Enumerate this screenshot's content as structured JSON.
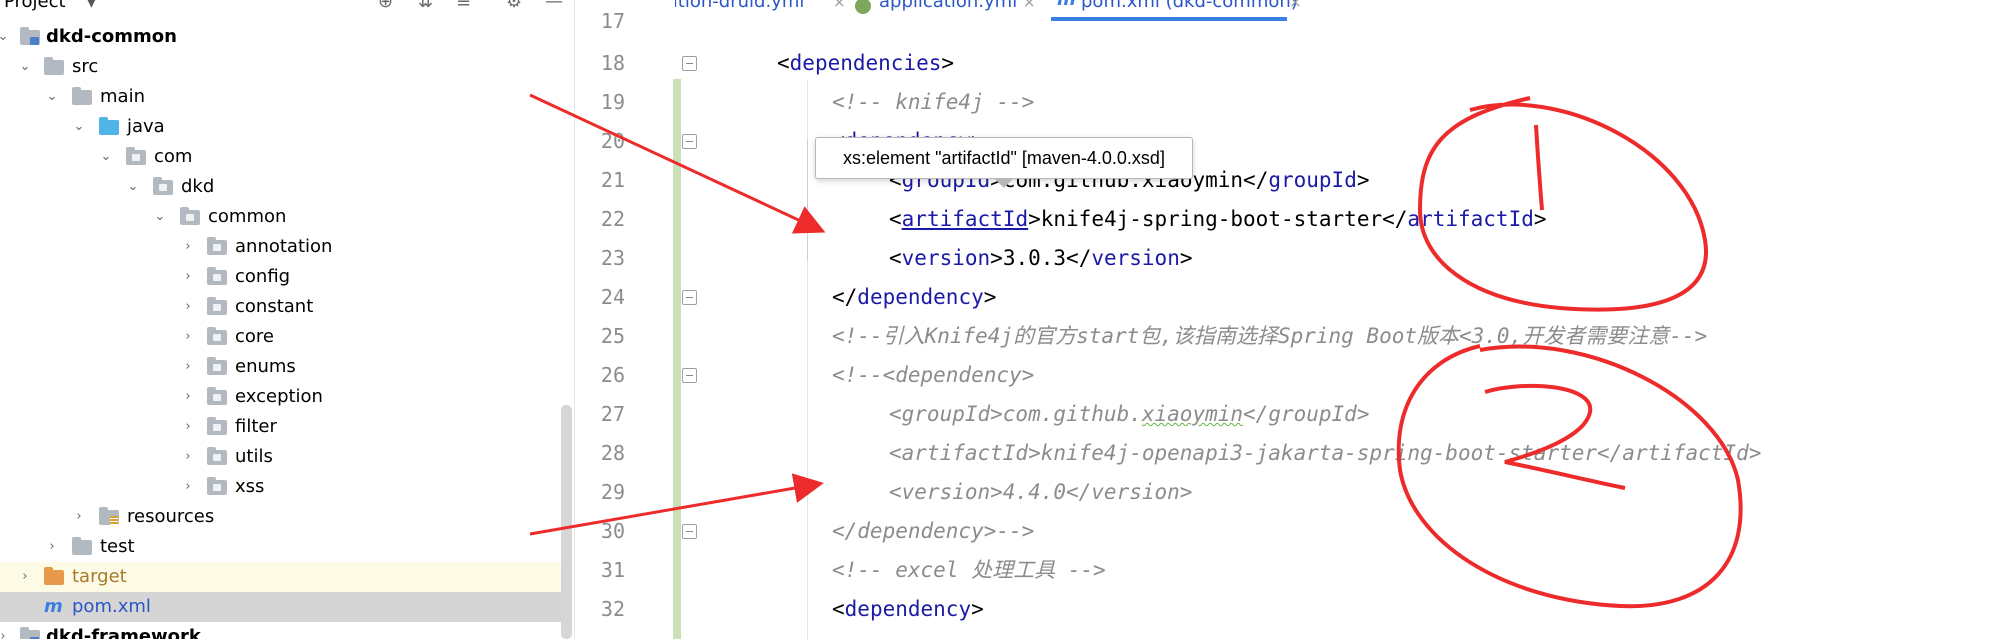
{
  "project": {
    "title": "Project",
    "tree": [
      {
        "label": "dkd-common",
        "kind": "module",
        "bold": true
      },
      {
        "label": "src"
      },
      {
        "label": "main"
      },
      {
        "label": "java"
      },
      {
        "label": "com"
      },
      {
        "label": "dkd"
      },
      {
        "label": "common"
      },
      {
        "label": "annotation"
      },
      {
        "label": "config"
      },
      {
        "label": "constant"
      },
      {
        "label": "core"
      },
      {
        "label": "enums"
      },
      {
        "label": "exception"
      },
      {
        "label": "filter"
      },
      {
        "label": "utils"
      },
      {
        "label": "xss"
      },
      {
        "label": "resources"
      },
      {
        "label": "test"
      },
      {
        "label": "target"
      },
      {
        "label": "pom.xml"
      },
      {
        "label": "dkd-framework"
      }
    ]
  },
  "tabs": [
    {
      "label": "application-druid.yml",
      "active": false
    },
    {
      "label": "application.yml",
      "active": false
    },
    {
      "label": "pom.xml (dkd-common)",
      "active": true
    }
  ],
  "tab_close_glyph": "×",
  "file_icon_letter": "m",
  "editor": {
    "line_numbers": [
      "17",
      "18",
      "19",
      "20",
      "21",
      "22",
      "23",
      "24",
      "25",
      "26",
      "27",
      "28",
      "29",
      "30",
      "31",
      "32"
    ],
    "code": {
      "l18_tag": "dependencies",
      "l19_comment": "<!-- knife4j -->",
      "l20_tag": "dependency",
      "l21_groupId": "groupId",
      "l21_value": "com.github.xiaoymin",
      "l22_artifactId": "artifactId",
      "l22_value": "knife4j-spring-boot-starter",
      "l23_version": "version",
      "l23_value": "3.0.3",
      "l24_tag": "dependency",
      "l25_comment": "<!--引入Knife4j的官方start包,该指南选择Spring Boot版本<3.0,开发者需要注意-->",
      "l26_comment": "<!--<dependency>",
      "l27_comment_pre": "<groupId>com.github.",
      "l27_comment_sq": "xiaoymin",
      "l27_comment_post": "</groupId>",
      "l28_comment": "<artifactId>knife4j-openapi3-jakarta-spring-boot-starter</artifactId>",
      "l29_comment": "<version>4.4.0</version>",
      "l30_comment": "</dependency>-->",
      "l31_comment": "<!-- excel 处理工具 -->",
      "l32_tag": "dependency"
    },
    "tooltip": "xs:element \"artifactId\" [maven-4.0.0.xsd]"
  },
  "colors": {
    "annotation_red": "#ee2b2b",
    "tag_blue": "#1a1aa6",
    "comment_gray": "#8c8c8c",
    "selection_tab": "#3a7ee0"
  }
}
